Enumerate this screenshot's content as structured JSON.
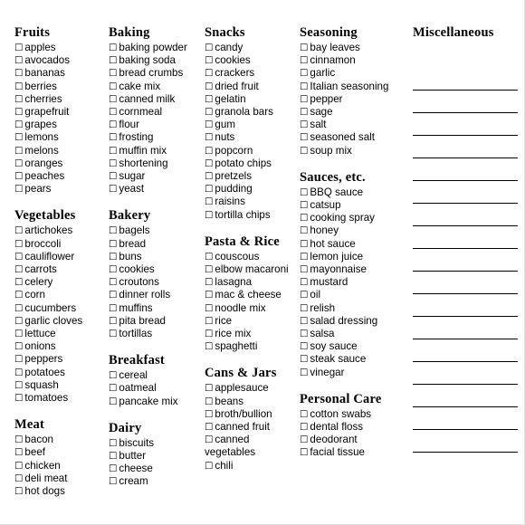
{
  "document": {
    "type": "grocery-shopping-list",
    "checkbox_glyph": "☐",
    "text_color": "#000000",
    "background_color": "#ffffff",
    "border_color": "#e2e2e2",
    "rule_color": "#000000"
  },
  "columns": [
    {
      "id": "column-1",
      "sections": [
        {
          "title": "Fruits",
          "items": [
            "apples",
            "avocados",
            "bananas",
            "berries",
            "cherries",
            "grapefruit",
            "grapes",
            "lemons",
            "melons",
            "oranges",
            "peaches",
            "pears"
          ]
        },
        {
          "title": "Vegetables",
          "items": [
            "artichokes",
            "broccoli",
            "cauliflower",
            "carrots",
            "celery",
            "corn",
            "cucumbers",
            "garlic cloves",
            "lettuce",
            "onions",
            "peppers",
            "potatoes",
            "squash",
            "tomatoes"
          ]
        },
        {
          "title": "Meat",
          "items": [
            "bacon",
            "beef",
            "chicken",
            "deli meat",
            "hot dogs"
          ]
        }
      ]
    },
    {
      "id": "column-2",
      "sections": [
        {
          "title": "Baking",
          "items": [
            "baking powder",
            "baking soda",
            "bread crumbs",
            "cake mix",
            "canned milk",
            "cornmeal",
            "flour",
            "frosting",
            "muffin mix",
            "shortening",
            "sugar",
            "yeast"
          ]
        },
        {
          "title": "Bakery",
          "items": [
            "bagels",
            "bread",
            "buns",
            "cookies",
            "croutons",
            "dinner rolls",
            "muffins",
            "pita bread",
            "tortillas"
          ]
        },
        {
          "title": "Breakfast",
          "items": [
            "cereal",
            "oatmeal",
            "pancake mix"
          ]
        },
        {
          "title": "Dairy",
          "items": [
            "biscuits",
            "butter",
            "cheese",
            "cream"
          ]
        }
      ]
    },
    {
      "id": "column-3",
      "sections": [
        {
          "title": "Snacks",
          "items": [
            "candy",
            "cookies",
            "crackers",
            "dried fruit",
            "gelatin",
            "granola bars",
            "gum",
            "nuts",
            "popcorn",
            "potato chips",
            "pretzels",
            "pudding",
            "raisins",
            "tortilla chips"
          ]
        },
        {
          "title": "Pasta & Rice",
          "items": [
            "couscous",
            "elbow macaroni",
            "lasagna",
            "mac & cheese",
            "noodle mix",
            "rice",
            "rice mix",
            "spaghetti"
          ]
        },
        {
          "title": "Cans & Jars",
          "items": [
            "applesauce",
            "beans",
            "broth/bullion",
            "canned fruit",
            "canned vegetables",
            "chili"
          ]
        }
      ]
    },
    {
      "id": "column-4",
      "sections": [
        {
          "title": "Seasoning",
          "items": [
            "bay leaves",
            "cinnamon",
            "garlic",
            "Italian seasoning",
            "pepper",
            "sage",
            "salt",
            "seasoned salt",
            "soup mix"
          ]
        },
        {
          "title": "Sauces, etc.",
          "items": [
            "BBQ sauce",
            "catsup",
            "cooking spray",
            "honey",
            "hot sauce",
            "lemon juice",
            "mayonnaise",
            "mustard",
            "oil",
            "relish",
            "salad dressing",
            "salsa",
            "soy sauce",
            "steak sauce",
            "vinegar"
          ]
        },
        {
          "title": "Personal Care",
          "items": [
            "cotton swabs",
            "dental floss",
            "deodorant",
            "facial tissue"
          ]
        }
      ]
    }
  ],
  "miscellaneous": {
    "title": "Miscellaneous",
    "blank_line_count": 17,
    "lines": [
      "",
      "",
      "",
      "",
      "",
      "",
      "",
      "",
      "",
      "",
      "",
      "",
      "",
      "",
      "",
      "",
      ""
    ]
  }
}
